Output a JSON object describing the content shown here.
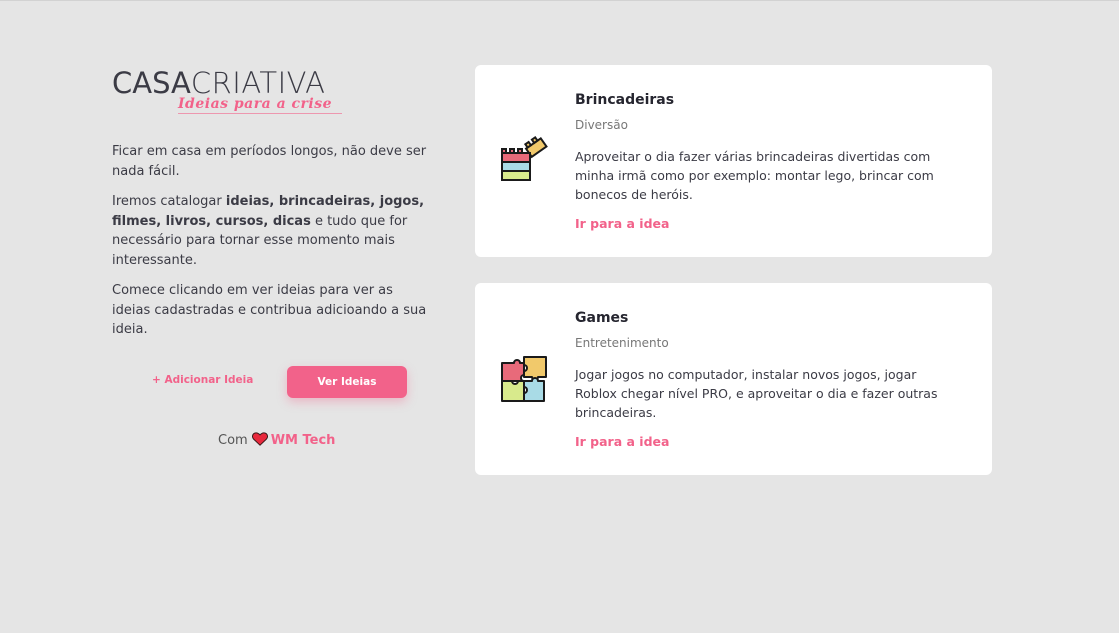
{
  "logo": {
    "main_part1": "CASA",
    "main_part2": "CRIATIVA",
    "tagline": "Ideias para a crise"
  },
  "intro": {
    "p1": "Ficar em casa em períodos longos, não deve ser nada fácil.",
    "p2_prefix": "Iremos catalogar ",
    "p2_bold": "ideias, brincadeiras, jogos, filmes, livros, cursos, dicas",
    "p2_suffix": " e tudo que for necessário para tornar esse momento mais interessante.",
    "p3": "Comece clicando em ver ideias para ver as ideias cadastradas e contribua adicioando a sua ideia."
  },
  "actions": {
    "add_label": "+ Adicionar Ideia",
    "view_label": "Ver Ideias"
  },
  "credits": {
    "prefix": "Com",
    "brand": "WM Tech",
    "heart_icon": "heart-icon"
  },
  "cards": [
    {
      "title": "Brincadeiras",
      "category": "Diversão",
      "description": "Aproveitar o dia fazer várias brincadeiras divertidas com minha irmã como por exemplo: montar lego, brincar com bonecos de heróis.",
      "link": "Ir para a idea",
      "icon": "lego-blocks-icon"
    },
    {
      "title": "Games",
      "category": "Entretenimento",
      "description": "Jogar jogos no computador, instalar novos jogos, jogar Roblox chegar nível PRO, e aproveitar o dia e fazer outras brincadeiras.",
      "link": "Ir para a idea",
      "icon": "puzzle-icon"
    }
  ],
  "colors": {
    "accent": "#f2628a",
    "background": "#e5e5e5",
    "card": "#ffffff",
    "text": "#3b3b45"
  }
}
